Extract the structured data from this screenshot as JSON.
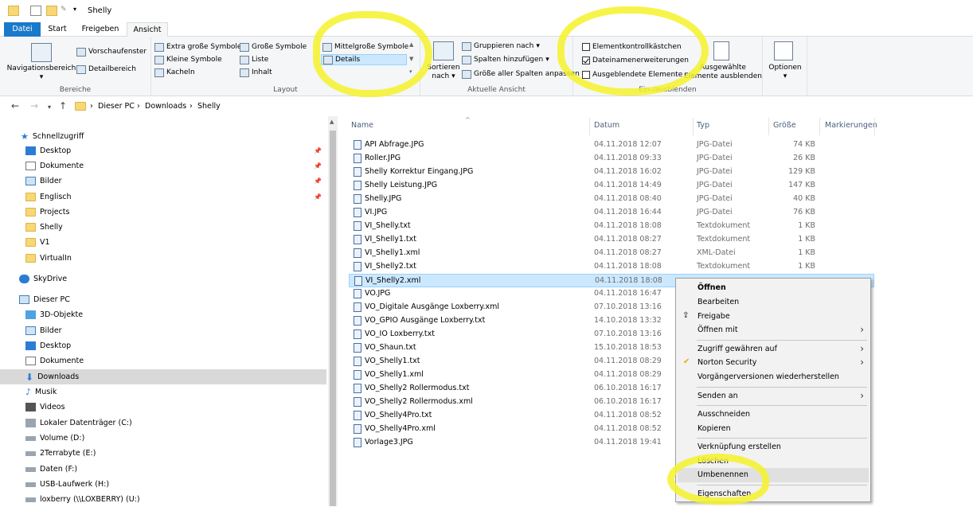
{
  "window": {
    "title": "Shelly"
  },
  "tabs": [
    "Datei",
    "Start",
    "Freigeben",
    "Ansicht"
  ],
  "ribbon": {
    "bereiche": {
      "navigationsbereich": "Navigationsbereich",
      "vorschaufenster": "Vorschaufenster",
      "detailbereich": "Detailbereich",
      "label": "Bereiche"
    },
    "layout": {
      "items": [
        "Extra große Symbole",
        "Große Symbole",
        "Mittelgroße Symbole",
        "Kleine Symbole",
        "Liste",
        "Details",
        "Kacheln",
        "Inhalt"
      ],
      "label": "Layout"
    },
    "aktuelle_ansicht": {
      "sortieren": "Sortieren",
      "nach": "nach",
      "gruppieren": "Gruppieren nach",
      "spalten": "Spalten hinzufügen",
      "groesse": "Größe aller Spalten anpassen",
      "label": "Aktuelle Ansicht"
    },
    "einaus": {
      "elementkontroll": "Elementkontrollkästchen",
      "dateinamen": "Dateinamenerweiterungen",
      "ausgeblendete": "Ausgeblendete Elemente",
      "ausgewaehlte_1": "Ausgewählte",
      "ausgewaehlte_2": "Elemente ausblenden",
      "label": "Ein-/ausblenden"
    },
    "optionen": {
      "label": "Optionen"
    }
  },
  "address": {
    "crumbs": [
      "Dieser PC",
      "Downloads",
      "Shelly"
    ]
  },
  "nav": {
    "items": [
      {
        "label": "Schnellzugriff",
        "y": 0
      },
      {
        "label": "Desktop"
      },
      {
        "label": "Dokumente"
      },
      {
        "label": "Bilder"
      },
      {
        "label": "Englisch"
      },
      {
        "label": "Projects"
      },
      {
        "label": "Shelly"
      },
      {
        "label": "V1"
      },
      {
        "label": "VirtualIn"
      },
      {
        "label": "SkyDrive"
      },
      {
        "label": "Dieser PC"
      },
      {
        "label": "3D-Objekte"
      },
      {
        "label": "Bilder"
      },
      {
        "label": "Desktop"
      },
      {
        "label": "Dokumente"
      },
      {
        "label": "Downloads"
      },
      {
        "label": "Musik"
      },
      {
        "label": "Videos"
      },
      {
        "label": "Lokaler Datenträger (C:)"
      },
      {
        "label": "Volume (D:)"
      },
      {
        "label": "2Terrabyte (E:)"
      },
      {
        "label": "Daten (F:)"
      },
      {
        "label": "USB-Laufwerk (H:)"
      },
      {
        "label": "loxberry (\\\\LOXBERRY) (U:)"
      }
    ]
  },
  "columns": {
    "name": "Name",
    "datum": "Datum",
    "typ": "Typ",
    "groesse": "Größe",
    "markierungen": "Markierungen"
  },
  "files": [
    {
      "name": "API Abfrage.JPG",
      "date": "04.11.2018 12:07",
      "type": "JPG-Datei",
      "size": "74 KB"
    },
    {
      "name": "Roller.JPG",
      "date": "04.11.2018 09:33",
      "type": "JPG-Datei",
      "size": "26 KB"
    },
    {
      "name": "Shelly Korrektur Eingang.JPG",
      "date": "04.11.2018 16:02",
      "type": "JPG-Datei",
      "size": "129 KB"
    },
    {
      "name": "Shelly Leistung.JPG",
      "date": "04.11.2018 14:49",
      "type": "JPG-Datei",
      "size": "147 KB"
    },
    {
      "name": "Shelly.JPG",
      "date": "04.11.2018 08:40",
      "type": "JPG-Datei",
      "size": "40 KB"
    },
    {
      "name": "VI.JPG",
      "date": "04.11.2018 16:44",
      "type": "JPG-Datei",
      "size": "76 KB"
    },
    {
      "name": "VI_Shelly.txt",
      "date": "04.11.2018 18:08",
      "type": "Textdokument",
      "size": "1 KB"
    },
    {
      "name": "VI_Shelly1.txt",
      "date": "04.11.2018 08:27",
      "type": "Textdokument",
      "size": "1 KB"
    },
    {
      "name": "VI_Shelly1.xml",
      "date": "04.11.2018 08:27",
      "type": "XML-Datei",
      "size": "1 KB"
    },
    {
      "name": "VI_Shelly2.txt",
      "date": "04.11.2018 18:08",
      "type": "Textdokument",
      "size": "1 KB"
    },
    {
      "name": "VI_Shelly2.xml",
      "date": "04.11.2018 18:08",
      "type": "",
      "size": ""
    },
    {
      "name": "VO.JPG",
      "date": "04.11.2018 16:47",
      "type": "",
      "size": ""
    },
    {
      "name": "VO_Digitale Ausgänge Loxberry.xml",
      "date": "07.10.2018 13:16",
      "type": "",
      "size": ""
    },
    {
      "name": "VO_GPIO Ausgänge Loxberry.txt",
      "date": "14.10.2018 13:32",
      "type": "",
      "size": ""
    },
    {
      "name": "VO_IO Loxberry.txt",
      "date": "07.10.2018 13:16",
      "type": "",
      "size": ""
    },
    {
      "name": "VO_Shaun.txt",
      "date": "15.10.2018 18:53",
      "type": "",
      "size": ""
    },
    {
      "name": "VO_Shelly1.txt",
      "date": "04.11.2018 08:29",
      "type": "",
      "size": ""
    },
    {
      "name": "VO_Shelly1.xml",
      "date": "04.11.2018 08:29",
      "type": "",
      "size": ""
    },
    {
      "name": "VO_Shelly2 Rollermodus.txt",
      "date": "06.10.2018 16:17",
      "type": "",
      "size": ""
    },
    {
      "name": "VO_Shelly2 Rollermodus.xml",
      "date": "06.10.2018 16:17",
      "type": "",
      "size": ""
    },
    {
      "name": "VO_Shelly4Pro.txt",
      "date": "04.11.2018 08:52",
      "type": "",
      "size": ""
    },
    {
      "name": "VO_Shelly4Pro.xml",
      "date": "04.11.2018 08:52",
      "type": "",
      "size": ""
    },
    {
      "name": "Vorlage3.JPG",
      "date": "04.11.2018 19:41",
      "type": "",
      "size": ""
    }
  ],
  "context_menu": {
    "items": [
      "Öffnen",
      "Bearbeiten",
      "Freigabe",
      "Öffnen mit",
      "Zugriff gewähren auf",
      "Norton Security",
      "Vorgängerversionen wiederherstellen",
      "Senden an",
      "Ausschneiden",
      "Kopieren",
      "Verknüpfung erstellen",
      "Löschen",
      "Umbenennen",
      "Eigenschaften"
    ]
  },
  "colors": {
    "accent": "#1979ca",
    "selection": "#cce8ff",
    "highlighter": "#f5f22a"
  }
}
